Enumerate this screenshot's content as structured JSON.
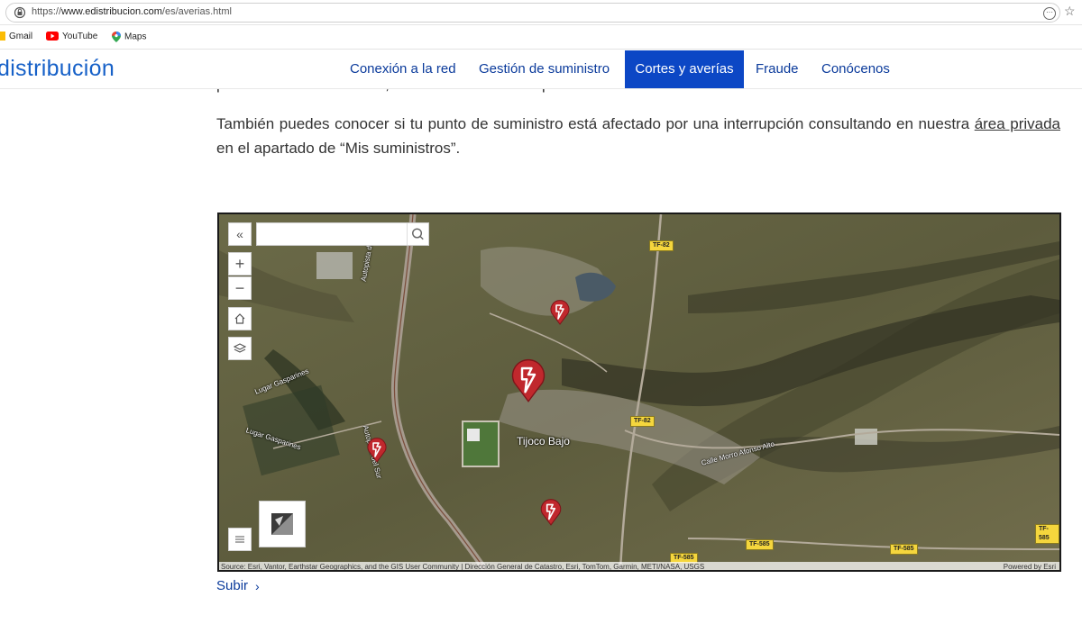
{
  "browser": {
    "url_prefix": "https://",
    "url_host": "www.edistribucion.com",
    "url_path": "/es/averias.html",
    "bookmarks": [
      {
        "label": "Gmail"
      },
      {
        "label": "YouTube"
      },
      {
        "label": "Maps"
      }
    ]
  },
  "header": {
    "logo": "distribución",
    "nav": [
      {
        "label": "Conexión a la red"
      },
      {
        "label": "Gestión de suministro"
      },
      {
        "label": "Cortes y averías"
      },
      {
        "label": "Fraude"
      },
      {
        "label": "Conócenos"
      }
    ],
    "active_color": "#0c47c5"
  },
  "content": {
    "cut_line": "para restaurar el servicio, en el momento en el que se conoce.",
    "para_before_link": "También puedes conocer si tu punto de suministro está afectado por una interrupción consultando en nuestra ",
    "link_text": "área privada",
    "para_after_link": " en el apartado de “Mis suministros”."
  },
  "map": {
    "search_placeholder": "",
    "places": [
      {
        "label": "Tijoco Bajo"
      },
      {
        "label": "Lugar Gasparines"
      },
      {
        "label": "Lugar Gasparines"
      },
      {
        "label": "Autopista del Sur"
      },
      {
        "label": "Autopista del Sur"
      },
      {
        "label": "Calle Morro Afonso Alto"
      }
    ],
    "road_badges": [
      "TF-82",
      "TF-82",
      "TF-585",
      "TF-585",
      "TF-585",
      "TF-585"
    ],
    "attribution": "Source: Esri, Vantor, Earthstar Geographics, and the GIS User Community | Dirección General de Catastro, Esri, TomTom, Garmin, METI/NASA, USGS",
    "powered_by": "Powered by Esri",
    "pin_color": "#c0282d"
  },
  "footer": {
    "subir": "Subir",
    "chevron": "›"
  }
}
